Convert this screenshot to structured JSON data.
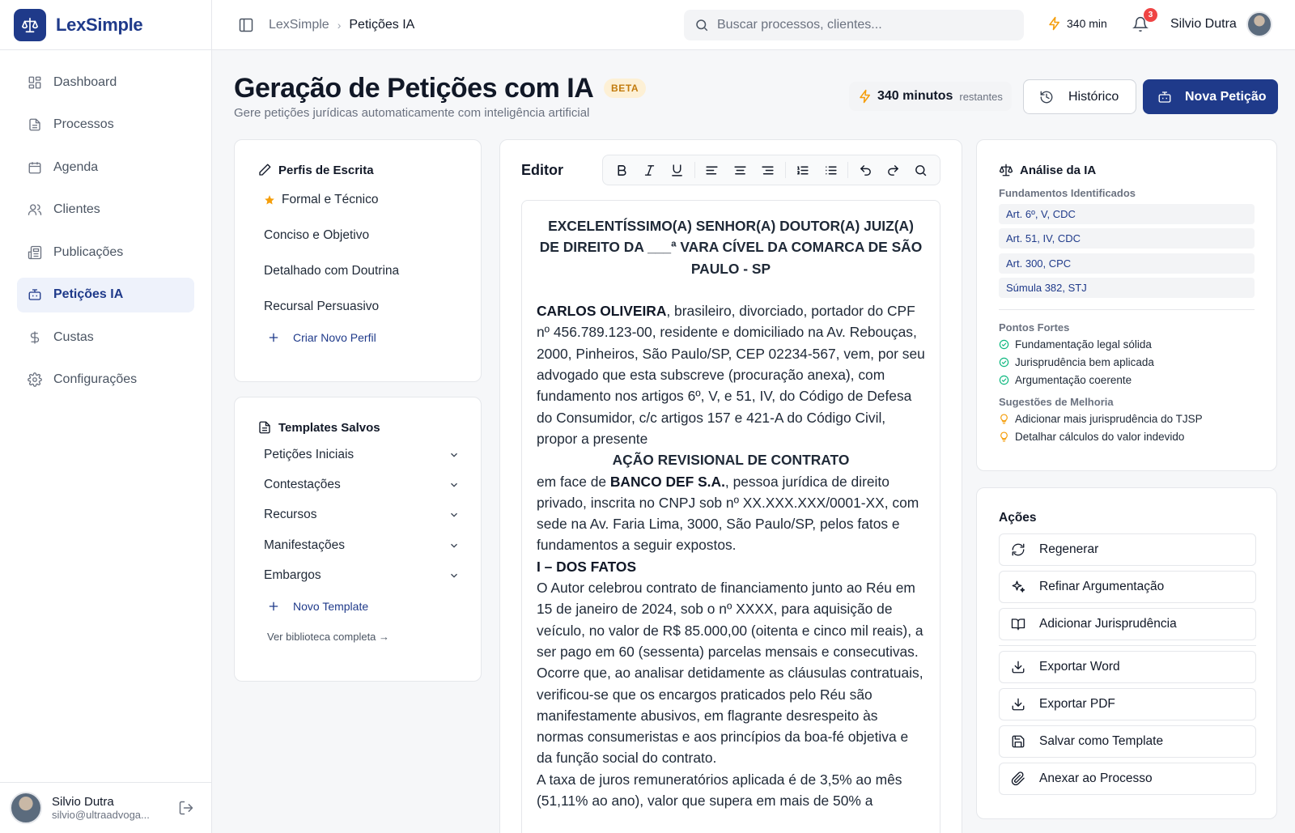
{
  "brand": {
    "name": "LexSimple",
    "logo_icon": "scale-icon"
  },
  "sidebar": {
    "items": [
      {
        "label": "Dashboard",
        "icon": "grid-icon"
      },
      {
        "label": "Processos",
        "icon": "file-icon"
      },
      {
        "label": "Agenda",
        "icon": "calendar-icon"
      },
      {
        "label": "Clientes",
        "icon": "users-icon"
      },
      {
        "label": "Publicações",
        "icon": "newspaper-icon"
      },
      {
        "label": "Petições IA",
        "icon": "bot-icon",
        "active": true
      },
      {
        "label": "Custas",
        "icon": "dollar-icon"
      },
      {
        "label": "Configurações",
        "icon": "gear-icon"
      }
    ],
    "user": {
      "name": "Silvio Dutra",
      "email": "silvio@ultraadvoga..."
    }
  },
  "topbar": {
    "breadcrumb": [
      "LexSimple",
      "Petições IA"
    ],
    "search_placeholder": "Buscar processos, clientes...",
    "minutes": "340 min",
    "notifications": "3",
    "user_name": "Silvio Dutra"
  },
  "header": {
    "title": "Geração de Petições com IA",
    "badge": "BETA",
    "subtitle": "Gere petições jurídicas automaticamente com inteligência artificial",
    "minutes_value": "340 minutos",
    "minutes_suffix": "restantes",
    "history_label": "Histórico",
    "new_label": "Nova Petição"
  },
  "profiles": {
    "title": "Perfis de Escrita",
    "items": [
      "Formal e Técnico",
      "Conciso e Objetivo",
      "Detalhado com Doutrina",
      "Recursal Persuasivo"
    ],
    "add_label": "Criar Novo Perfil"
  },
  "templates": {
    "title": "Templates Salvos",
    "items": [
      "Petições Iniciais",
      "Contestações",
      "Recursos",
      "Manifestações",
      "Embargos"
    ],
    "add_label": "Novo Template",
    "library_link": "Ver biblioteca completa →"
  },
  "editor": {
    "label": "Editor",
    "heading": "EXCELENTÍSSIMO(A) SENHOR(A) DOUTOR(A) JUIZ(A) DE DIREITO DA ___ª VARA CÍVEL DA COMARCA DE SÃO PAULO - SP",
    "author_name": "CARLOS OLIVEIRA",
    "author_text": ", brasileiro, divorciado, portador do CPF nº 456.789.123-00, residente e domiciliado na Av. Rebouças, 2000, Pinheiros, São Paulo/SP, CEP 02234-567, vem, por seu advogado que esta subscreve (procuração anexa), com fundamento nos artigos 6º, V, e 51, IV, do Código de Defesa do Consumidor, c/c artigos 157 e 421-A do Código Civil, propor a presente",
    "action_title": "AÇÃO REVISIONAL DE CONTRATO",
    "against_prefix": "em face de ",
    "defendant_name": "BANCO DEF S.A.",
    "defendant_text": ", pessoa jurídica de direito privado, inscrita no CNPJ sob nº XX.XXX.XXX/0001-XX, com sede na Av. Faria Lima, 3000, São Paulo/SP, pelos fatos e fundamentos a seguir expostos.",
    "section_title": "I – DOS FATOS",
    "para1": "O Autor celebrou contrato de financiamento junto ao Réu em 15 de janeiro de 2024, sob o nº XXXX, para aquisição de veículo, no valor de R$ 85.000,00 (oitenta e cinco mil reais), a ser pago em 60 (sessenta) parcelas mensais e consecutivas.",
    "para2": "Ocorre que, ao analisar detidamente as cláusulas contratuais, verificou-se que os encargos praticados pelo Réu são manifestamente abusivos, em flagrante desrespeito às normas consumeristas e aos princípios da boa-fé objetiva e da função social do contrato.",
    "para3": "A taxa de juros remuneratórios aplicada é de 3,5% ao mês (51,11% ao ano), valor que supera em mais de 50% a"
  },
  "analysis": {
    "title": "Análise da IA",
    "fund_label": "Fundamentos Identificados",
    "fundamentos": [
      "Art. 6º, V, CDC",
      "Art. 51, IV, CDC",
      "Art. 300, CPC",
      "Súmula 382, STJ"
    ],
    "strengths_label": "Pontos Fortes",
    "strengths": [
      "Fundamentação legal sólida",
      "Jurisprudência bem aplicada",
      "Argumentação coerente"
    ],
    "suggestions_label": "Sugestões de Melhoria",
    "suggestions": [
      "Adicionar mais jurisprudência do TJSP",
      "Detalhar cálculos do valor indevido"
    ]
  },
  "actions": {
    "title": "Ações",
    "items": [
      {
        "label": "Regenerar",
        "icon": "refresh-icon"
      },
      {
        "label": "Refinar Argumentação",
        "icon": "sparkles-icon"
      },
      {
        "label": "Adicionar Jurisprudência",
        "icon": "book-icon"
      },
      {
        "label": "Exportar Word",
        "icon": "download-icon"
      },
      {
        "label": "Exportar PDF",
        "icon": "download-icon"
      },
      {
        "label": "Salvar como Template",
        "icon": "save-icon"
      },
      {
        "label": "Anexar ao Processo",
        "icon": "paperclip-icon"
      }
    ]
  },
  "colors": {
    "primary": "#1f3a8a",
    "accent": "#f59e0b",
    "success": "#10b981",
    "danger": "#ef4444"
  }
}
